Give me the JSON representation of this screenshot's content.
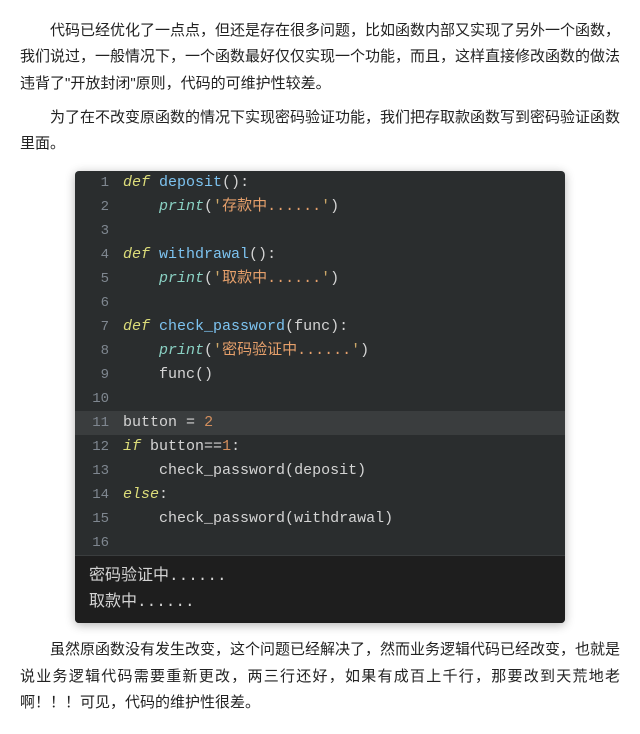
{
  "paragraphs": {
    "p1": "代码已经优化了一点点，但还是存在很多问题，比如函数内部又实现了另外一个函数，我们说过，一般情况下，一个函数最好仅仅实现一个功能，而且，这样直接修改函数的做法违背了\"开放封闭\"原则，代码的可维护性较差。",
    "p2": "为了在不改变原函数的情况下实现密码验证功能，我们把存取款函数写到密码验证函数里面。",
    "p3": "虽然原函数没有发生改变，这个问题已经解决了，然而业务逻辑代码已经改变，也就是说业务逻辑代码需要重新更改，两三行还好，如果有成百上千行，那要改到天荒地老啊！！！可见，代码的维护性很差。"
  },
  "code": {
    "lines": [
      {
        "n": "1",
        "tokens": [
          {
            "t": "kw",
            "s": "def"
          },
          {
            "t": "sp",
            "s": " "
          },
          {
            "t": "fn",
            "s": "deposit"
          },
          {
            "t": "par",
            "s": "()"
          },
          {
            "t": "op",
            "s": ":"
          }
        ]
      },
      {
        "n": "2",
        "indent": 1,
        "tokens": [
          {
            "t": "builtin",
            "s": "print"
          },
          {
            "t": "par",
            "s": "("
          },
          {
            "t": "str",
            "s": "'"
          },
          {
            "t": "strcn",
            "s": "存款中......"
          },
          {
            "t": "str",
            "s": "'"
          },
          {
            "t": "par",
            "s": ")"
          }
        ]
      },
      {
        "n": "3",
        "tokens": []
      },
      {
        "n": "4",
        "tokens": [
          {
            "t": "kw",
            "s": "def"
          },
          {
            "t": "sp",
            "s": " "
          },
          {
            "t": "fn",
            "s": "withdrawal"
          },
          {
            "t": "par",
            "s": "()"
          },
          {
            "t": "op",
            "s": ":"
          }
        ]
      },
      {
        "n": "5",
        "indent": 1,
        "tokens": [
          {
            "t": "builtin",
            "s": "print"
          },
          {
            "t": "par",
            "s": "("
          },
          {
            "t": "str",
            "s": "'"
          },
          {
            "t": "strcn",
            "s": "取款中......"
          },
          {
            "t": "str",
            "s": "'"
          },
          {
            "t": "par",
            "s": ")"
          }
        ]
      },
      {
        "n": "6",
        "tokens": []
      },
      {
        "n": "7",
        "tokens": [
          {
            "t": "kw",
            "s": "def"
          },
          {
            "t": "sp",
            "s": " "
          },
          {
            "t": "fn",
            "s": "check_password"
          },
          {
            "t": "par",
            "s": "("
          },
          {
            "t": "ident",
            "s": "func"
          },
          {
            "t": "par",
            "s": ")"
          },
          {
            "t": "op",
            "s": ":"
          }
        ]
      },
      {
        "n": "8",
        "indent": 1,
        "tokens": [
          {
            "t": "builtin",
            "s": "print"
          },
          {
            "t": "par",
            "s": "("
          },
          {
            "t": "str",
            "s": "'"
          },
          {
            "t": "strcn",
            "s": "密码验证中......"
          },
          {
            "t": "str",
            "s": "'"
          },
          {
            "t": "par",
            "s": ")"
          }
        ]
      },
      {
        "n": "9",
        "indent": 1,
        "tokens": [
          {
            "t": "ident",
            "s": "func"
          },
          {
            "t": "par",
            "s": "()"
          }
        ]
      },
      {
        "n": "10",
        "tokens": []
      },
      {
        "n": "11",
        "hl": true,
        "tokens": [
          {
            "t": "var",
            "s": "button"
          },
          {
            "t": "sp",
            "s": " "
          },
          {
            "t": "op",
            "s": "="
          },
          {
            "t": "sp",
            "s": " "
          },
          {
            "t": "num",
            "s": "2"
          }
        ]
      },
      {
        "n": "12",
        "tokens": [
          {
            "t": "kw",
            "s": "if"
          },
          {
            "t": "sp",
            "s": " "
          },
          {
            "t": "ident",
            "s": "button"
          },
          {
            "t": "op",
            "s": "=="
          },
          {
            "t": "num",
            "s": "1"
          },
          {
            "t": "op",
            "s": ":"
          }
        ]
      },
      {
        "n": "13",
        "indent": 1,
        "tokens": [
          {
            "t": "ident",
            "s": "check_password"
          },
          {
            "t": "par",
            "s": "("
          },
          {
            "t": "ident",
            "s": "deposit"
          },
          {
            "t": "par",
            "s": ")"
          }
        ]
      },
      {
        "n": "14",
        "tokens": [
          {
            "t": "kw",
            "s": "else"
          },
          {
            "t": "op",
            "s": ":"
          }
        ]
      },
      {
        "n": "15",
        "indent": 1,
        "tokens": [
          {
            "t": "ident",
            "s": "check_password"
          },
          {
            "t": "par",
            "s": "("
          },
          {
            "t": "ident",
            "s": "withdrawal"
          },
          {
            "t": "par",
            "s": ")"
          }
        ]
      },
      {
        "n": "16",
        "tokens": []
      }
    ],
    "output": [
      "密码验证中......",
      "取款中......"
    ]
  }
}
